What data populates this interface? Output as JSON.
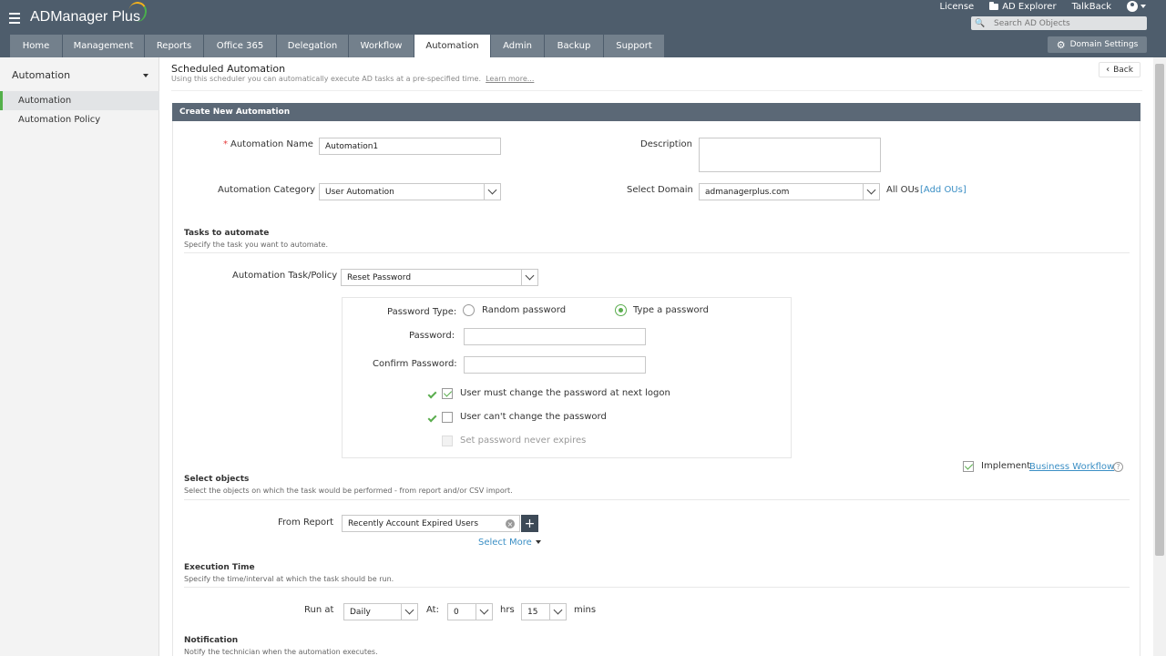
{
  "app": {
    "logo": "ADManager Plus"
  },
  "toplinks": {
    "license": "License",
    "ad_explorer": "AD Explorer",
    "talkback": "TalkBack"
  },
  "search": {
    "placeholder": "Search AD Objects"
  },
  "tabs": [
    "Home",
    "Management",
    "Reports",
    "Office 365",
    "Delegation",
    "Workflow",
    "Automation",
    "Admin",
    "Backup",
    "Support"
  ],
  "active_tab": "Automation",
  "domain_settings": "Domain Settings",
  "sidebar": {
    "heading": "Automation",
    "items": [
      "Automation",
      "Automation Policy"
    ]
  },
  "page": {
    "title": "Scheduled Automation",
    "subtitle": "Using this scheduler you can automatically execute AD tasks at a pre-specified time.",
    "learn_more": "Learn more...",
    "back": "Back"
  },
  "form": {
    "panel_title": "Create New Automation",
    "name_required": "*",
    "name_label": "Automation Name",
    "name_value": "Automation1",
    "description_label": "Description",
    "description_value": "",
    "category_label": "Automation Category",
    "category_value": "User Automation",
    "domain_label": "Select Domain",
    "domain_value": "admanagerplus.com",
    "all_ous": "All OUs",
    "add_ous": "[Add OUs]",
    "tasks": {
      "title": "Tasks to automate",
      "subtitle": "Specify the task you want to automate.",
      "task_label": "Automation Task/Policy",
      "task_value": "Reset Password",
      "password_type_label": "Password Type:",
      "random_password": "Random password",
      "type_password": "Type a password",
      "selected_password_type": "Type a password",
      "password_label": "Password:",
      "password_value": "",
      "confirm_label": "Confirm Password:",
      "confirm_value": "",
      "options": [
        {
          "label": "User must change the password at next logon",
          "checked": true,
          "disabled": false
        },
        {
          "label": "User can't change the password",
          "checked": false,
          "disabled": false
        },
        {
          "label": "Set password never expires",
          "checked": false,
          "disabled": true
        }
      ]
    },
    "implement_label": "Implement",
    "business_workflow": "Business Workflow",
    "implement_checked": true,
    "objects": {
      "title": "Select objects",
      "subtitle": "Select the objects on which the task would be performed - from report and/or CSV import.",
      "from_report_label": "From Report",
      "report_value": "Recently Account Expired Users",
      "select_more": "Select More"
    },
    "execution": {
      "title": "Execution Time",
      "subtitle": "Specify the time/interval at which the task should be run.",
      "run_at_label": "Run at",
      "frequency": "Daily",
      "at_label": "At:",
      "hours": "0",
      "hrs_label": "hrs",
      "minutes": "15",
      "mins_label": "mins"
    },
    "notification": {
      "title": "Notification",
      "subtitle": "Notify the technician when the automation executes."
    }
  },
  "colors": {
    "header_bg": "#4e5d6c",
    "tab_bg": "#73808c",
    "panel_head_bg": "#5b6876",
    "accent_green": "#5aad4e",
    "link_blue": "#3b8fc5"
  }
}
